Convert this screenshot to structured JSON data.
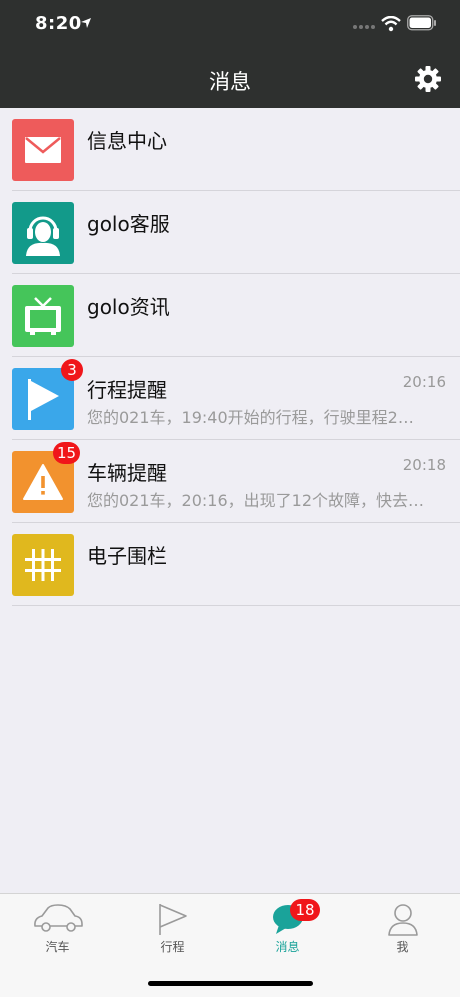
{
  "status_bar": {
    "time": "8:20"
  },
  "header": {
    "title": "消息"
  },
  "messages": [
    {
      "title": "信息中心",
      "icon": "mail-icon",
      "color": "#ee5b5b"
    },
    {
      "title": "golo客服",
      "icon": "headset-agent-icon",
      "color": "#129a8a"
    },
    {
      "title": "golo资讯",
      "icon": "tv-icon",
      "color": "#45c55a"
    },
    {
      "title": "行程提醒",
      "icon": "flag-icon",
      "color": "#3aa7ea",
      "time": "20:16",
      "subtitle": "您的021车，19:40开始的行程，行驶里程2…",
      "badge": "3"
    },
    {
      "title": "车辆提醒",
      "icon": "warning-icon",
      "color": "#f2922e",
      "time": "20:18",
      "subtitle": "您的021车，20:16，出现了12个故障，快去…",
      "badge": "15"
    },
    {
      "title": "电子围栏",
      "icon": "fence-icon",
      "color": "#e0b81e"
    }
  ],
  "tabs": [
    {
      "label": "汽车",
      "icon": "car-icon"
    },
    {
      "label": "行程",
      "icon": "flag-outline-icon"
    },
    {
      "label": "消息",
      "icon": "chat-bubble-icon",
      "badge": "18",
      "active": true
    },
    {
      "label": "我",
      "icon": "person-icon"
    }
  ],
  "colors": {
    "header_bg": "#2e302f",
    "accent": "#1aa39a",
    "badge": "#f0161a"
  }
}
